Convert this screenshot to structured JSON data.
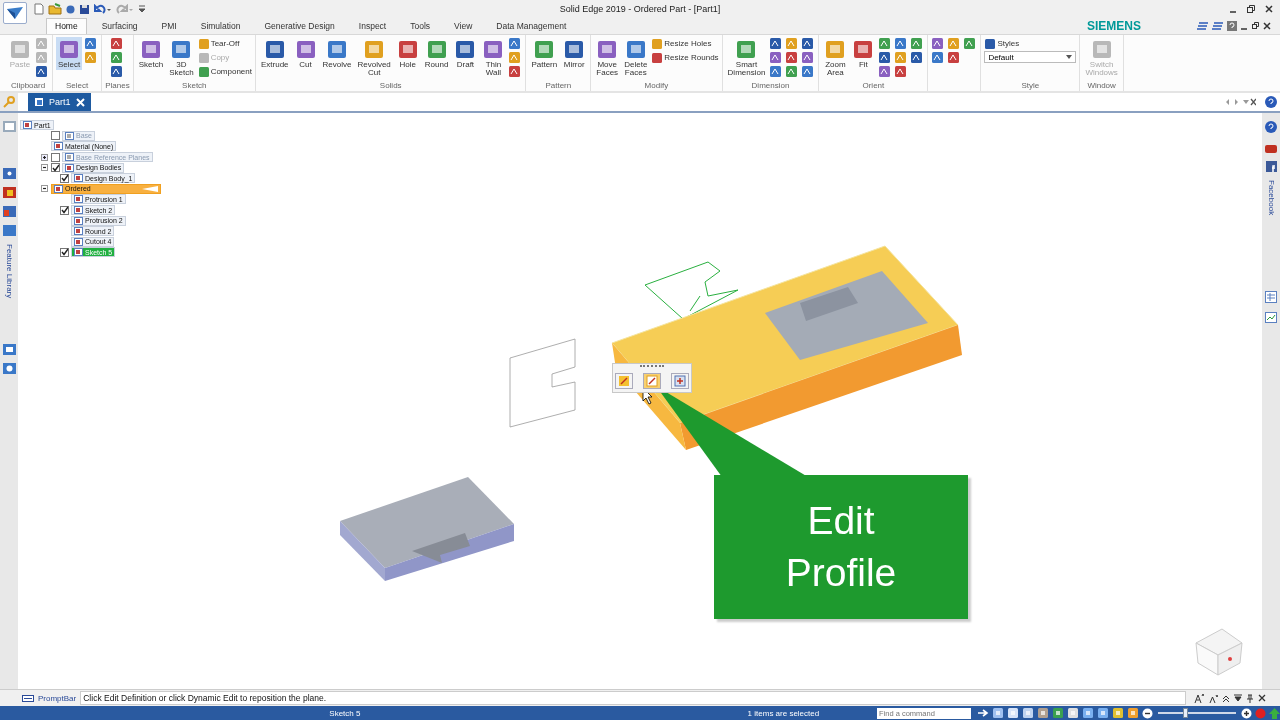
{
  "window": {
    "title": "Solid Edge 2019 - Ordered Part - [Part1]"
  },
  "tabs": [
    {
      "label": "Home",
      "selected": true
    },
    {
      "label": "Surfacing",
      "selected": false
    },
    {
      "label": "PMI",
      "selected": false
    },
    {
      "label": "Simulation",
      "selected": false
    },
    {
      "label": "Generative Design",
      "selected": false
    },
    {
      "label": "Inspect",
      "selected": false
    },
    {
      "label": "Tools",
      "selected": false
    },
    {
      "label": "View",
      "selected": false
    },
    {
      "label": "Data Management",
      "selected": false
    }
  ],
  "brand": "SIEMENS",
  "ribbon": [
    {
      "label": "Clipboard",
      "items": [
        {
          "kind": "large",
          "label": "Paste",
          "disabled": true,
          "selected": false
        },
        {
          "kind": "column",
          "buttons": [
            {
              "kind": "icon",
              "disabled": true
            },
            {
              "kind": "icon",
              "disabled": true
            },
            {
              "kind": "icon",
              "disabled": false
            }
          ]
        }
      ]
    },
    {
      "label": "Select",
      "items": [
        {
          "kind": "large",
          "label": "Select",
          "disabled": false,
          "selected": true
        },
        {
          "kind": "column",
          "buttons": [
            {
              "kind": "icon",
              "disabled": false
            },
            {
              "kind": "icon",
              "disabled": false
            }
          ]
        }
      ]
    },
    {
      "label": "Planes",
      "items": [
        {
          "kind": "column",
          "buttons": [
            {
              "kind": "icon",
              "disabled": false
            },
            {
              "kind": "icon",
              "disabled": false
            },
            {
              "kind": "icon",
              "disabled": false
            }
          ]
        }
      ]
    },
    {
      "label": "Sketch",
      "items": [
        {
          "kind": "large",
          "label": "Sketch",
          "disabled": false,
          "selected": false
        },
        {
          "kind": "large",
          "label": "3D Sketch",
          "disabled": false,
          "selected": false
        },
        {
          "kind": "column",
          "buttons": [
            {
              "kind": "small",
              "label": "Tear-Off",
              "disabled": false
            },
            {
              "kind": "small",
              "label": "Copy",
              "disabled": true
            },
            {
              "kind": "small",
              "label": "Component",
              "disabled": false
            }
          ]
        }
      ]
    },
    {
      "label": "Solids",
      "items": [
        {
          "kind": "large",
          "label": "Extrude",
          "disabled": false,
          "selected": false
        },
        {
          "kind": "large",
          "label": "Cut",
          "disabled": false,
          "selected": false
        },
        {
          "kind": "large",
          "label": "Revolve",
          "disabled": false,
          "selected": false
        },
        {
          "kind": "large",
          "label": "Revolved Cut",
          "disabled": false,
          "selected": false
        },
        {
          "kind": "large",
          "label": "Hole",
          "disabled": false,
          "selected": false
        },
        {
          "kind": "large",
          "label": "Round",
          "disabled": false,
          "selected": false
        },
        {
          "kind": "large",
          "label": "Draft",
          "disabled": false,
          "selected": false
        },
        {
          "kind": "large",
          "label": "Thin Wall",
          "disabled": false,
          "selected": false
        },
        {
          "kind": "column",
          "buttons": [
            {
              "kind": "icon",
              "disabled": false
            },
            {
              "kind": "icon",
              "disabled": false
            },
            {
              "kind": "icon",
              "disabled": false
            }
          ]
        }
      ]
    },
    {
      "label": "Pattern",
      "items": [
        {
          "kind": "large",
          "label": "Pattern",
          "disabled": false,
          "selected": false
        },
        {
          "kind": "large",
          "label": "Mirror",
          "disabled": false,
          "selected": false
        }
      ]
    },
    {
      "label": "Modify",
      "items": [
        {
          "kind": "large",
          "label": "Move Faces",
          "disabled": false,
          "selected": false
        },
        {
          "kind": "large",
          "label": "Delete Faces",
          "disabled": false,
          "selected": false
        },
        {
          "kind": "column",
          "buttons": [
            {
              "kind": "small",
              "label": "Resize Holes",
              "disabled": false
            },
            {
              "kind": "small",
              "label": "Resize Rounds",
              "disabled": false
            }
          ]
        }
      ]
    },
    {
      "label": "Dimension",
      "items": [
        {
          "kind": "large",
          "label": "Smart Dimension",
          "disabled": false,
          "selected": false
        },
        {
          "kind": "column",
          "buttons": [
            {
              "kind": "icon",
              "disabled": false
            },
            {
              "kind": "icon",
              "disabled": false
            },
            {
              "kind": "icon",
              "disabled": false
            }
          ]
        },
        {
          "kind": "column",
          "buttons": [
            {
              "kind": "icon",
              "disabled": false
            },
            {
              "kind": "icon",
              "disabled": false
            },
            {
              "kind": "icon",
              "disabled": false
            }
          ]
        },
        {
          "kind": "column",
          "buttons": [
            {
              "kind": "icon",
              "disabled": false
            },
            {
              "kind": "icon",
              "disabled": false
            },
            {
              "kind": "icon",
              "disabled": false
            }
          ]
        }
      ]
    },
    {
      "label": "Orient",
      "items": [
        {
          "kind": "large",
          "label": "Zoom Area",
          "disabled": false,
          "selected": false
        },
        {
          "kind": "large",
          "label": "Fit",
          "disabled": false,
          "selected": false
        },
        {
          "kind": "column",
          "buttons": [
            {
              "kind": "icon",
              "disabled": false
            },
            {
              "kind": "icon",
              "disabled": false
            },
            {
              "kind": "icon",
              "disabled": false
            }
          ]
        },
        {
          "kind": "column",
          "buttons": [
            {
              "kind": "icon",
              "disabled": false
            },
            {
              "kind": "icon",
              "disabled": false
            },
            {
              "kind": "icon",
              "disabled": false
            }
          ]
        },
        {
          "kind": "column",
          "buttons": [
            {
              "kind": "icon",
              "disabled": false
            },
            {
              "kind": "icon",
              "disabled": false
            }
          ]
        }
      ]
    },
    {
      "items": [
        {
          "kind": "column",
          "buttons": [
            {
              "kind": "icon",
              "disabled": false
            },
            {
              "kind": "icon",
              "disabled": false
            }
          ]
        },
        {
          "kind": "column",
          "buttons": [
            {
              "kind": "icon",
              "disabled": false
            },
            {
              "kind": "icon",
              "disabled": false
            }
          ]
        },
        {
          "kind": "column",
          "buttons": [
            {
              "kind": "icon",
              "disabled": false
            }
          ]
        }
      ]
    },
    {
      "label": "Style",
      "items": [
        {
          "kind": "column",
          "buttons": [
            {
              "kind": "small",
              "label": "Styles",
              "disabled": false
            },
            {
              "kind": "dropdown",
              "value": "Default"
            }
          ]
        }
      ]
    },
    {
      "label": "Window",
      "items": [
        {
          "kind": "large",
          "label": "Switch Windows",
          "disabled": true,
          "selected": false
        }
      ]
    }
  ],
  "document_tabs": [
    {
      "label": "Part1",
      "selected": true
    }
  ],
  "tree": [
    {
      "label": "Part1",
      "kind": "plain",
      "selected": false,
      "active": false,
      "disabled": false,
      "children": [
        {
          "label": "Base",
          "kind": "checkbox",
          "checked": false,
          "selected": false,
          "active": false,
          "disabled": true
        },
        {
          "label": "Material (None)",
          "kind": "plain",
          "selected": false,
          "active": false,
          "disabled": false
        },
        {
          "label": "Base Reference Planes",
          "kind": "checkbox",
          "checked": false,
          "expanded": false,
          "selected": false,
          "active": false,
          "disabled": true
        },
        {
          "label": "Design Bodies",
          "kind": "checkbox",
          "checked": true,
          "expanded": true,
          "selected": false,
          "active": false,
          "disabled": false,
          "children": [
            {
              "label": "Design Body_1",
              "kind": "checkbox",
              "checked": true,
              "selected": false,
              "active": false,
              "disabled": false
            }
          ]
        },
        {
          "label": "Ordered",
          "kind": "plain",
          "expanded": true,
          "selected": true,
          "active": false,
          "disabled": false,
          "children": [
            {
              "label": "Protrusion 1",
              "kind": "plain",
              "selected": false,
              "active": false,
              "disabled": false
            },
            {
              "label": "Sketch 2",
              "kind": "checkbox",
              "checked": true,
              "selected": false,
              "active": false,
              "disabled": false
            },
            {
              "label": "Protrusion 2",
              "kind": "plain",
              "selected": false,
              "active": false,
              "disabled": false
            },
            {
              "label": "Round 2",
              "kind": "plain",
              "selected": false,
              "active": false,
              "disabled": false
            },
            {
              "label": "Cutout 4",
              "kind": "plain",
              "selected": false,
              "active": false,
              "disabled": false
            },
            {
              "label": "Sketch 5",
              "kind": "checkbox",
              "checked": true,
              "selected": false,
              "active": true,
              "disabled": false
            }
          ]
        }
      ]
    }
  ],
  "left_panel": {
    "label": "Feature Library"
  },
  "right_panel": {
    "label": "Facebook"
  },
  "callout": {
    "text": "Edit Profile"
  },
  "prompt_bar": {
    "label": "PromptBar",
    "message": "Click Edit Definition or click Dynamic Edit to reposition the plane."
  },
  "status_bar": {
    "sketch": "Sketch 5",
    "selection": "1 items are selected",
    "command_search": {
      "placeholder": "Find a command"
    },
    "zoom_slider": {
      "level": 0.36
    }
  }
}
